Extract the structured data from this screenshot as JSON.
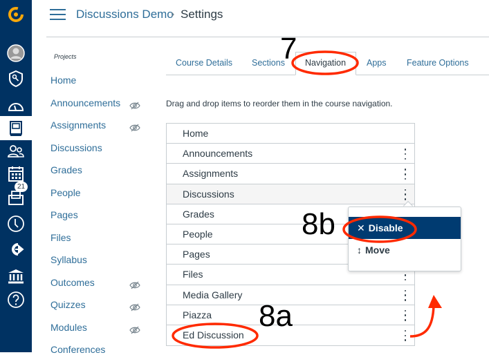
{
  "global_nav": {
    "color": "#003262",
    "items": [
      {
        "icon": "canvas-logo-icon"
      },
      {
        "icon": "account-avatar-icon"
      },
      {
        "icon": "admin-shield-icon"
      },
      {
        "icon": "dashboard-icon"
      },
      {
        "icon": "courses-icon",
        "active": true
      },
      {
        "icon": "groups-icon"
      },
      {
        "icon": "calendar-icon"
      },
      {
        "icon": "inbox-icon",
        "badge": "21"
      },
      {
        "icon": "history-icon"
      },
      {
        "icon": "commons-icon"
      },
      {
        "icon": "institution-icon"
      },
      {
        "icon": "help-icon"
      }
    ]
  },
  "header": {
    "course": "Discussions Demo",
    "separator": "›",
    "page": "Settings"
  },
  "course_nav": {
    "section_label": "Projects",
    "items": [
      {
        "label": "Home",
        "hidden": false
      },
      {
        "label": "Announcements",
        "hidden": true
      },
      {
        "label": "Assignments",
        "hidden": true
      },
      {
        "label": "Discussions",
        "hidden": false
      },
      {
        "label": "Grades",
        "hidden": false
      },
      {
        "label": "People",
        "hidden": false
      },
      {
        "label": "Pages",
        "hidden": false
      },
      {
        "label": "Files",
        "hidden": false
      },
      {
        "label": "Syllabus",
        "hidden": false
      },
      {
        "label": "Outcomes",
        "hidden": true
      },
      {
        "label": "Quizzes",
        "hidden": true
      },
      {
        "label": "Modules",
        "hidden": true
      },
      {
        "label": "Conferences",
        "hidden": false
      }
    ]
  },
  "tabs": [
    "Course Details",
    "Sections",
    "Navigation",
    "Apps",
    "Feature Options"
  ],
  "active_tab": "Navigation",
  "instructions": "Drag and drop items to reorder them in the course navigation.",
  "nav_list": [
    "Home",
    "Announcements",
    "Assignments",
    "Discussions",
    "Grades",
    "People",
    "Pages",
    "Files",
    "Media Gallery",
    "Piazza",
    "Ed Discussion"
  ],
  "menu": {
    "disable": "Disable",
    "move": "Move",
    "highlight_color": "#003b71"
  },
  "annotations": {
    "step7": "7",
    "step8a": "8a",
    "step8b": "8b",
    "color": "#ff2a00"
  }
}
